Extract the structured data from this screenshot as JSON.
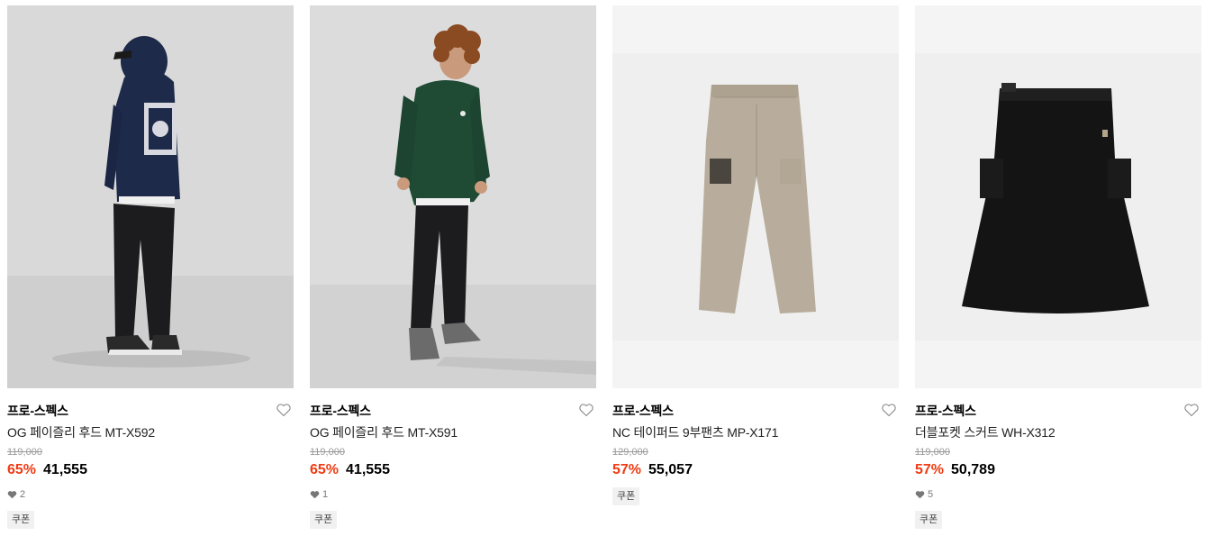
{
  "products": [
    {
      "brand": "프로-스펙스",
      "name": "OG 페이즐리 후드 MT-X592",
      "original_price": "119,000",
      "discount": "65%",
      "sale_price": "41,555",
      "likes": "2",
      "badge": "쿠폰",
      "image": "model-navy-paisley-hoodie-back-view"
    },
    {
      "brand": "프로-스펙스",
      "name": "OG 페이즐리 후드 MT-X591",
      "original_price": "119,000",
      "discount": "65%",
      "sale_price": "41,555",
      "likes": "1",
      "badge": "쿠폰",
      "image": "model-green-hoodie-front-view"
    },
    {
      "brand": "프로-스펙스",
      "name": "NC 테이퍼드 9부팬츠 MP-X171",
      "original_price": "129,000",
      "discount": "57%",
      "sale_price": "55,057",
      "badge": "쿠폰",
      "image": "beige-tapered-pants"
    },
    {
      "brand": "프로-스펙스",
      "name": "더블포켓 스커트 WH-X312",
      "original_price": "119,000",
      "discount": "57%",
      "sale_price": "50,789",
      "likes": "5",
      "badge": "쿠폰",
      "image": "black-pocket-skirt"
    }
  ],
  "colors": {
    "discount": "#f03c14",
    "original_price": "#9a9a9a",
    "badge_bg": "#f1f1f1"
  },
  "icons": {
    "wishlist": "heart-outline-icon",
    "likes": "heart-filled-icon"
  }
}
